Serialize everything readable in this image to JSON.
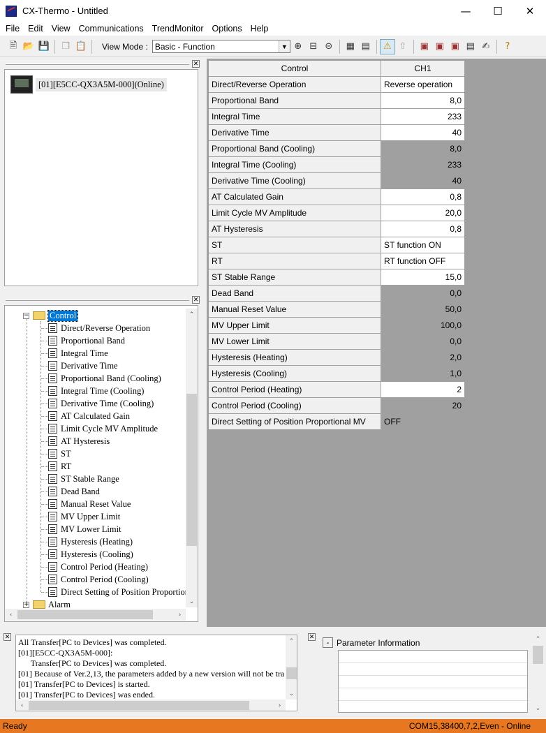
{
  "window": {
    "title": "CX-Thermo - Untitled"
  },
  "menu": [
    "File",
    "Edit",
    "View",
    "Communications",
    "TrendMonitor",
    "Options",
    "Help"
  ],
  "toolbar": {
    "view_mode_label": "View Mode :",
    "view_mode_value": "Basic - Function"
  },
  "device": {
    "label": "[01][E5CC-QX3A5M-000](Online)"
  },
  "tree": {
    "root": "Control",
    "items": [
      "Direct/Reverse Operation",
      "Proportional Band",
      "Integral Time",
      "Derivative Time",
      "Proportional Band (Cooling)",
      "Integral Time (Cooling)",
      "Derivative Time (Cooling)",
      "AT Calculated Gain",
      "Limit Cycle MV Amplitude",
      "AT Hysteresis",
      "ST",
      "RT",
      "ST Stable Range",
      "Dead Band",
      "Manual Reset Value",
      "MV Upper Limit",
      "MV Lower Limit",
      "Hysteresis (Heating)",
      "Hysteresis (Cooling)",
      "Control Period (Heating)",
      "Control Period (Cooling)",
      "Direct Setting of Position Proportion"
    ],
    "next": "Alarm"
  },
  "table": {
    "col_name": "Control",
    "col_ch": "CH1",
    "rows": [
      {
        "name": "Direct/Reverse Operation",
        "value": "Reverse operation",
        "type": "text",
        "enabled": true
      },
      {
        "name": "Proportional Band",
        "value": "8,0",
        "type": "num",
        "enabled": true
      },
      {
        "name": "Integral Time",
        "value": "233",
        "type": "num",
        "enabled": true
      },
      {
        "name": "Derivative Time",
        "value": "40",
        "type": "num",
        "enabled": true
      },
      {
        "name": "Proportional Band (Cooling)",
        "value": "8,0",
        "type": "num",
        "enabled": false
      },
      {
        "name": "Integral Time (Cooling)",
        "value": "233",
        "type": "num",
        "enabled": false
      },
      {
        "name": "Derivative Time (Cooling)",
        "value": "40",
        "type": "num",
        "enabled": false
      },
      {
        "name": "AT Calculated Gain",
        "value": "0,8",
        "type": "num",
        "enabled": true
      },
      {
        "name": "Limit Cycle MV Amplitude",
        "value": "20,0",
        "type": "num",
        "enabled": true
      },
      {
        "name": "AT Hysteresis",
        "value": "0,8",
        "type": "num",
        "enabled": true
      },
      {
        "name": "ST",
        "value": "ST function ON",
        "type": "text",
        "enabled": true
      },
      {
        "name": "RT",
        "value": "RT function OFF",
        "type": "text",
        "enabled": true
      },
      {
        "name": "ST Stable Range",
        "value": "15,0",
        "type": "num",
        "enabled": true
      },
      {
        "name": "Dead Band",
        "value": "0,0",
        "type": "num",
        "enabled": false
      },
      {
        "name": "Manual Reset Value",
        "value": "50,0",
        "type": "num",
        "enabled": false
      },
      {
        "name": "MV Upper Limit",
        "value": "100,0",
        "type": "num",
        "enabled": false
      },
      {
        "name": "MV Lower Limit",
        "value": "0,0",
        "type": "num",
        "enabled": false
      },
      {
        "name": "Hysteresis (Heating)",
        "value": "2,0",
        "type": "num",
        "enabled": false
      },
      {
        "name": "Hysteresis (Cooling)",
        "value": "1,0",
        "type": "num",
        "enabled": false
      },
      {
        "name": "Control Period (Heating)",
        "value": "2",
        "type": "num",
        "enabled": true
      },
      {
        "name": "Control Period (Cooling)",
        "value": "20",
        "type": "num",
        "enabled": false
      },
      {
        "name": "Direct Setting of Position Proportional MV",
        "value": "OFF",
        "type": "text",
        "enabled": false
      }
    ]
  },
  "log": [
    "All Transfer[PC to Devices] was completed.",
    "[01][E5CC-QX3A5M-000]:",
    "      Transfer[PC to Devices] was completed.",
    "[01] Because of Ver.2,13, the parameters added by a new version will not be tra",
    "[01] Transfer[PC to Devices] is started.",
    "[01] Transfer[PC to Devices] was ended."
  ],
  "param_info": {
    "title": "Parameter Information",
    "toggle": "-"
  },
  "status": {
    "left": "Ready",
    "right": "COM15,38400,7,2,Even - Online"
  },
  "colors": {
    "statusbar": "#e87722",
    "selection": "#0078d7",
    "disabled_cell": "#a0a0a0"
  }
}
